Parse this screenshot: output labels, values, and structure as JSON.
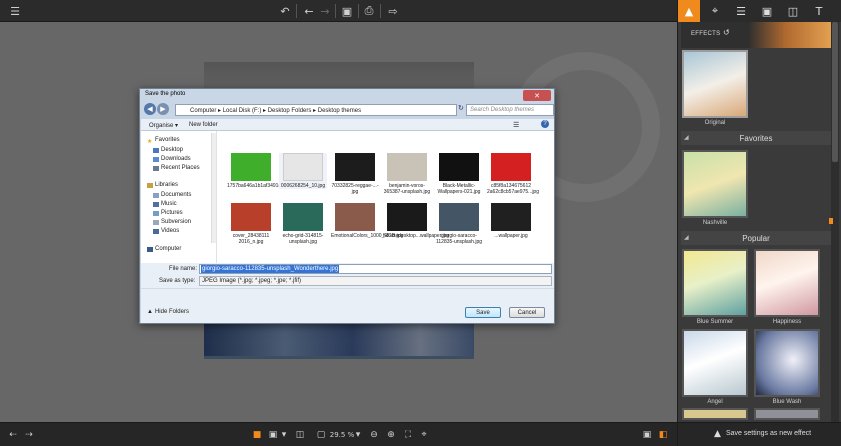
{
  "topbar": {
    "icons": [
      "menu-icon",
      "undo-icon",
      "back-icon",
      "forward-icon",
      "save-icon",
      "print-icon",
      "share-icon"
    ]
  },
  "right_panel": {
    "tabs": [
      "effects-icon",
      "crop-icon",
      "adjust-icon",
      "layers-icon",
      "frames-icon",
      "text-icon"
    ],
    "effects_label": "EFFECTS",
    "original_label": "Original",
    "favorites_header": "Favorites",
    "favorites": [
      {
        "label": "Nashville"
      }
    ],
    "popular_header": "Popular",
    "popular": [
      {
        "label": "Blue Summer"
      },
      {
        "label": "Happiness"
      },
      {
        "label": "Angel"
      },
      {
        "label": "Blue Wash"
      }
    ],
    "save_settings_label": "Save settings as new effect"
  },
  "bottombar": {
    "zoom": "29.5 %"
  },
  "dialog": {
    "title": "Save the photo",
    "address": "Computer ▸ Local Disk (F:) ▸ Desktop Folders ▸ Desktop themes",
    "search_placeholder": "Search Desktop themes",
    "organize": "Organise ▾",
    "new_folder": "New folder",
    "nav": {
      "favorites": "Favorites",
      "desktop": "Desktop",
      "downloads": "Downloads",
      "recent": "Recent Places",
      "libraries": "Libraries",
      "documents": "Documents",
      "music": "Music",
      "pictures": "Pictures",
      "subversion": "Subversion",
      "videos": "Videos",
      "computer": "Computer"
    },
    "files_row1": [
      {
        "name": "1757ba646a1b1af3491ee45620f20215.jpg",
        "color": "#3fae2a"
      },
      {
        "name": "0006268254_10.jpg",
        "color": "#e6e6e6"
      },
      {
        "name": "70332825-reggae-...-jpg",
        "color": "#1c1c1c"
      },
      {
        "name": "benjamin-voros-365387-unsplash.jpg",
        "color": "#c9c2b6"
      },
      {
        "name": "Black-Metallic-Wallpapers-021.jpg",
        "color": "#111111"
      },
      {
        "name": "c85f8a134675612 2a62c8cb57ae975...jpg",
        "color": "#d42020"
      }
    ],
    "files_row2": [
      {
        "name": "cover_28438111 2016_n.jpg",
        "color": "#b8402a"
      },
      {
        "name": "echo-grid-314815-unsplash.jpg",
        "color": "#2a6a5a"
      },
      {
        "name": "EmotionalColors_1000_RGB.jpg",
        "color": "#8a5a4a"
      },
      {
        "name": "fullsizedesktop...wallpaper.jpg",
        "color": "#1a1a1a"
      },
      {
        "name": "giorgio-saracco-112835-unsplash.jpg",
        "color": "#445566"
      },
      {
        "name": "...wallpaper.jpg",
        "color": "#202020"
      }
    ],
    "filename_label": "File name:",
    "filename_value": "giorgio-saracco-112835-unsplash_Wonderthere.jpg",
    "savetype_label": "Save as type:",
    "savetype_value": "JPEG Image (*.jpg; *.jpeg; *.jpe; *.jfif)",
    "hide_folders": "Hide Folders",
    "save": "Save",
    "cancel": "Cancel"
  }
}
